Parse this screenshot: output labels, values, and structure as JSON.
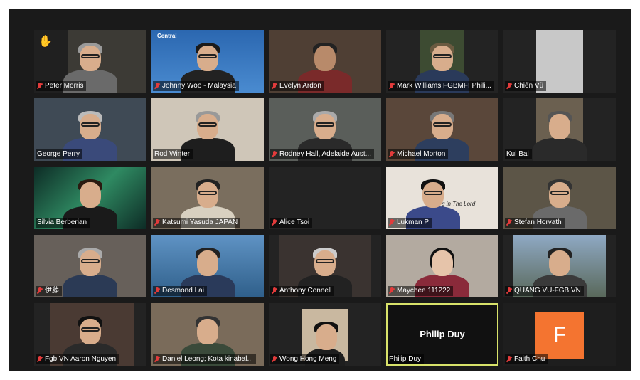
{
  "window": {
    "title": ""
  },
  "colors": {
    "background": "#1a1a1a",
    "mute_icon": "#e23b3b",
    "active_speaker_border": "#d8e26a",
    "avatar_orange": "#f47430"
  },
  "participants": [
    {
      "name": "Peter Morris",
      "muted": true,
      "raised_hand": true,
      "bg": "#3c3a35"
    },
    {
      "name": "Johnny Woo - Malaysia",
      "muted": true,
      "bg": "#2b67b0",
      "overlay_text": "Central"
    },
    {
      "name": "Evelyn Ardon",
      "muted": true,
      "bg": "#4f3f34"
    },
    {
      "name": "Mark Williams FGBMFI Phili...",
      "muted": true,
      "bg": "#3d4b32"
    },
    {
      "name": "Chiến Vũ",
      "muted": true,
      "bg": "#2d2d2d"
    },
    {
      "name": "George Perry",
      "muted": false,
      "bg": "#3f4a55"
    },
    {
      "name": "Rod Winter",
      "muted": false,
      "bg": "#7d6f63"
    },
    {
      "name": "Rodney Hall, Adelaide Aust...",
      "muted": true,
      "bg": "#5a5e5a"
    },
    {
      "name": "Michael Morton",
      "muted": true,
      "bg": "#5a473a"
    },
    {
      "name": "Kul Bal",
      "muted": false,
      "bg": "#6b6050"
    },
    {
      "name": "Silvia Berberian",
      "muted": false,
      "bg": "#154a3d"
    },
    {
      "name": "Katsumi Yasuda JAPAN",
      "muted": true,
      "bg": "#7a6e5e"
    },
    {
      "name": "Alice Tsoi",
      "muted": true,
      "bg": "#232323"
    },
    {
      "name": "Lukman P",
      "muted": true,
      "bg": "#c9b9a8",
      "overlay_text": "g in The Lord"
    },
    {
      "name": "Stefan Horvath",
      "muted": true,
      "bg": "#5c5547"
    },
    {
      "name": "伊藤",
      "muted": true,
      "bg": "#67605a"
    },
    {
      "name": "Desmond Lai",
      "muted": true,
      "bg": "#3e6f9c"
    },
    {
      "name": "Anthony Connell",
      "muted": true,
      "bg": "#3a3330"
    },
    {
      "name": "Maychee 111222",
      "muted": true,
      "bg": "#b3aaa0"
    },
    {
      "name": "QUANG VU-FGB VN",
      "muted": true,
      "bg": "#59685a"
    },
    {
      "name": "Fgb VN Aaron Nguyen",
      "muted": true,
      "bg": "#4a3a33"
    },
    {
      "name": "Daniel Leong; Kota kinabal...",
      "muted": true,
      "bg": "#7a6b5a"
    },
    {
      "name": "Wong Hong Meng",
      "muted": true,
      "bg": "#232323"
    },
    {
      "name": "Philip Duy",
      "muted": false,
      "bg": "#111111",
      "speaking": true,
      "center_name": "Philip Duy"
    },
    {
      "name": "Faith Chu",
      "muted": true,
      "bg": "#1e1e1e",
      "avatar_letter": "F"
    }
  ]
}
